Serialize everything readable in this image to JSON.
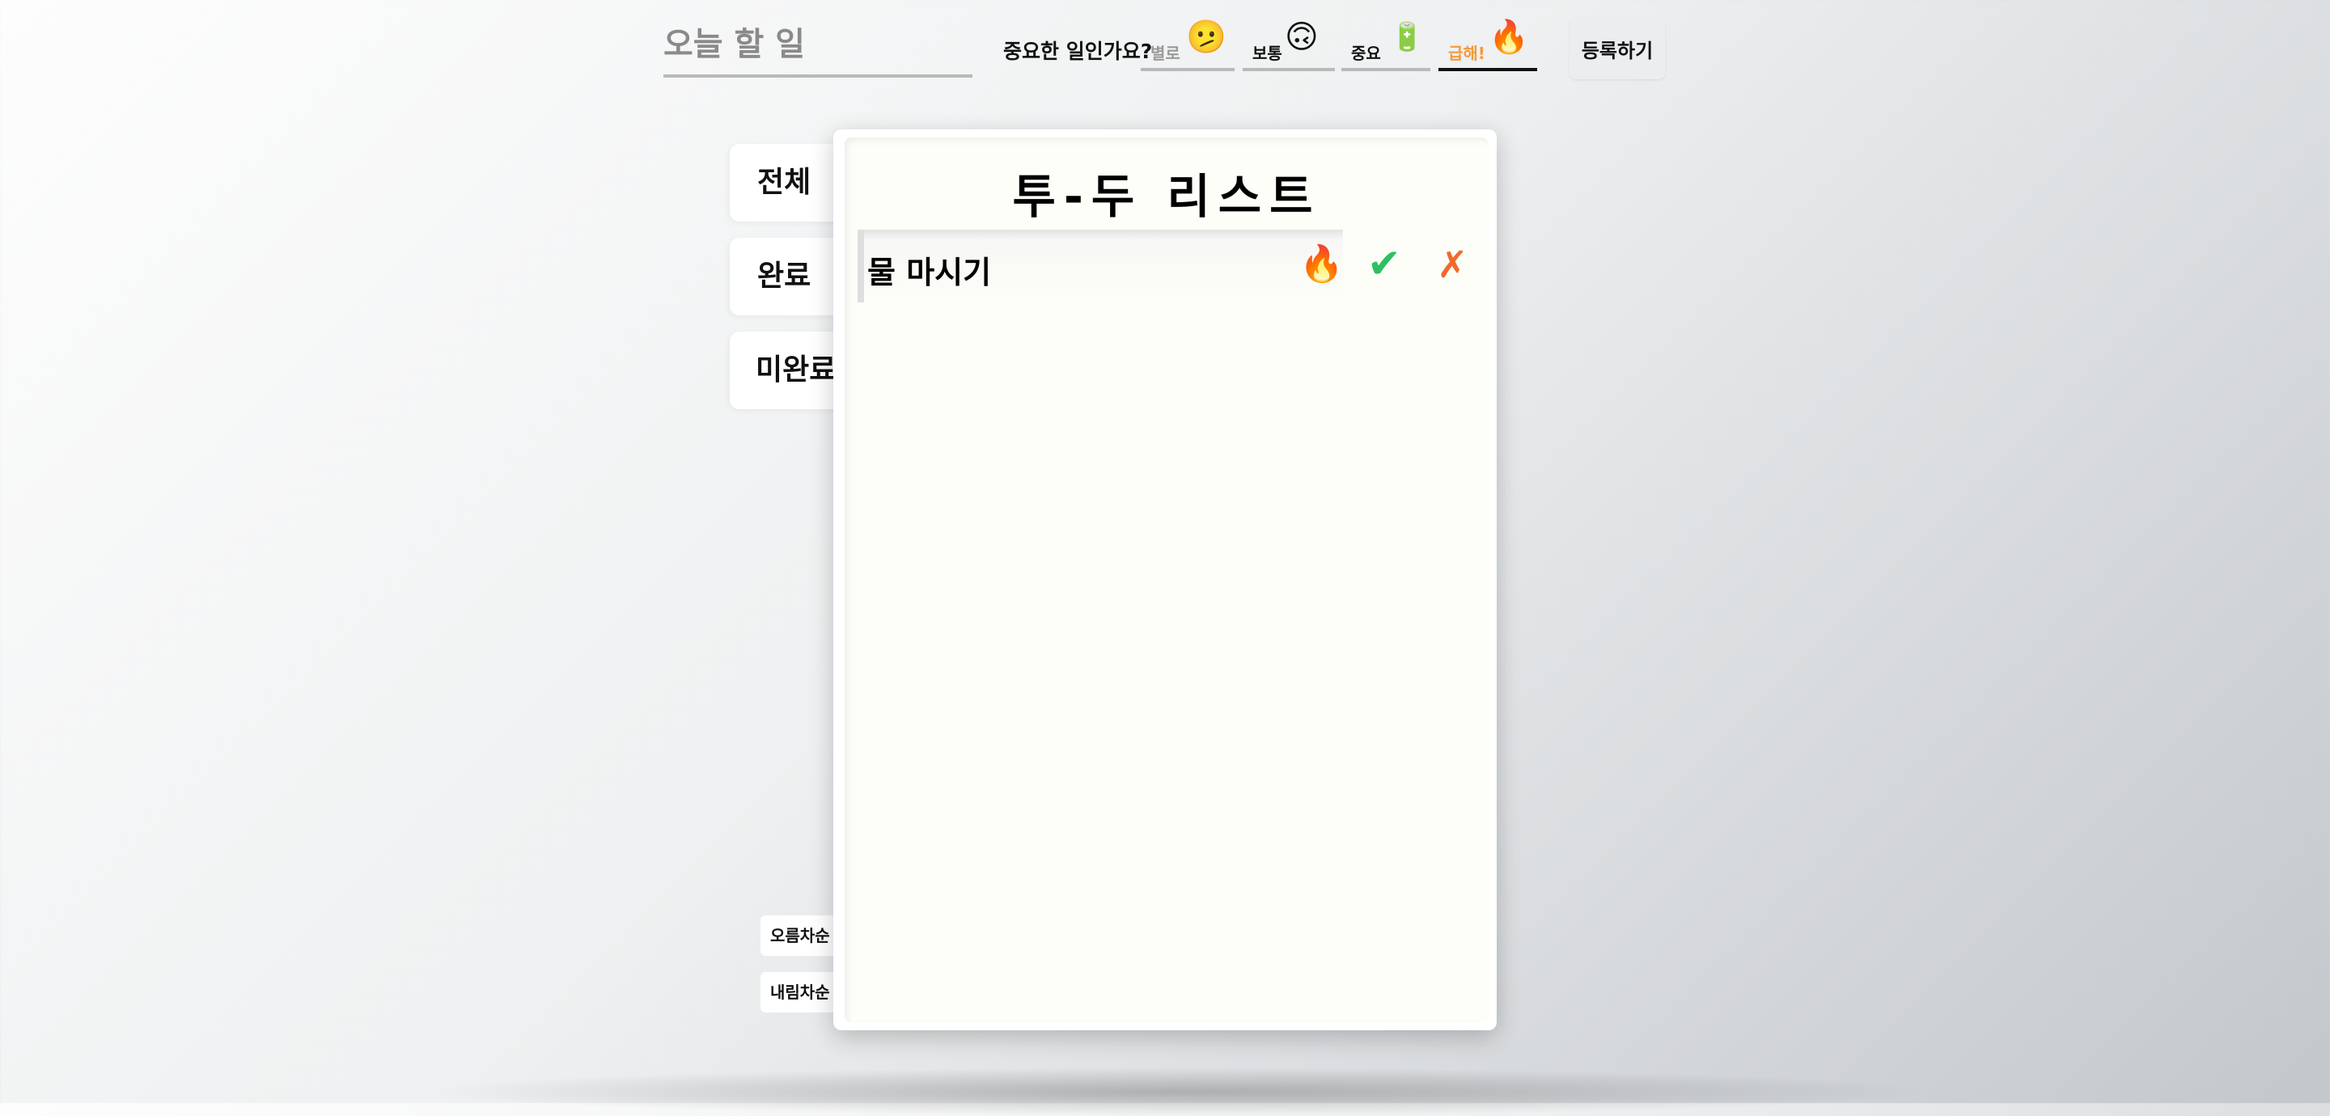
{
  "todo_input": {
    "placeholder": "오늘 할 일",
    "value": ""
  },
  "importance": {
    "question": "중요한 일인가요?",
    "selected": "급해!",
    "options": [
      {
        "label": "별로",
        "emoji": "🫤",
        "label_color": "#9a9a9a"
      },
      {
        "label": "보통",
        "emoji": "🙃",
        "label_color": "#111111"
      },
      {
        "label": "중요",
        "emoji": "🔋",
        "label_color": "#111111"
      },
      {
        "label": "급해!",
        "emoji": "🔥",
        "label_color": "#f39a3c"
      }
    ]
  },
  "register_button": {
    "label": "등록하기"
  },
  "filters": {
    "all": "전체",
    "completed": "완료",
    "incomplete": "미완료"
  },
  "sort": {
    "ascending": "오름차순",
    "descending": "내림차순"
  },
  "panel": {
    "title": "투-두 리스트"
  },
  "todos": [
    {
      "text": "물 마시기",
      "priority_icon": "🔥",
      "complete_icon": "✔",
      "delete_icon": "✗"
    }
  ],
  "colors": {
    "complete": "#2fbf62",
    "delete": "#f06a2b",
    "urgent_label": "#f39a3c"
  }
}
